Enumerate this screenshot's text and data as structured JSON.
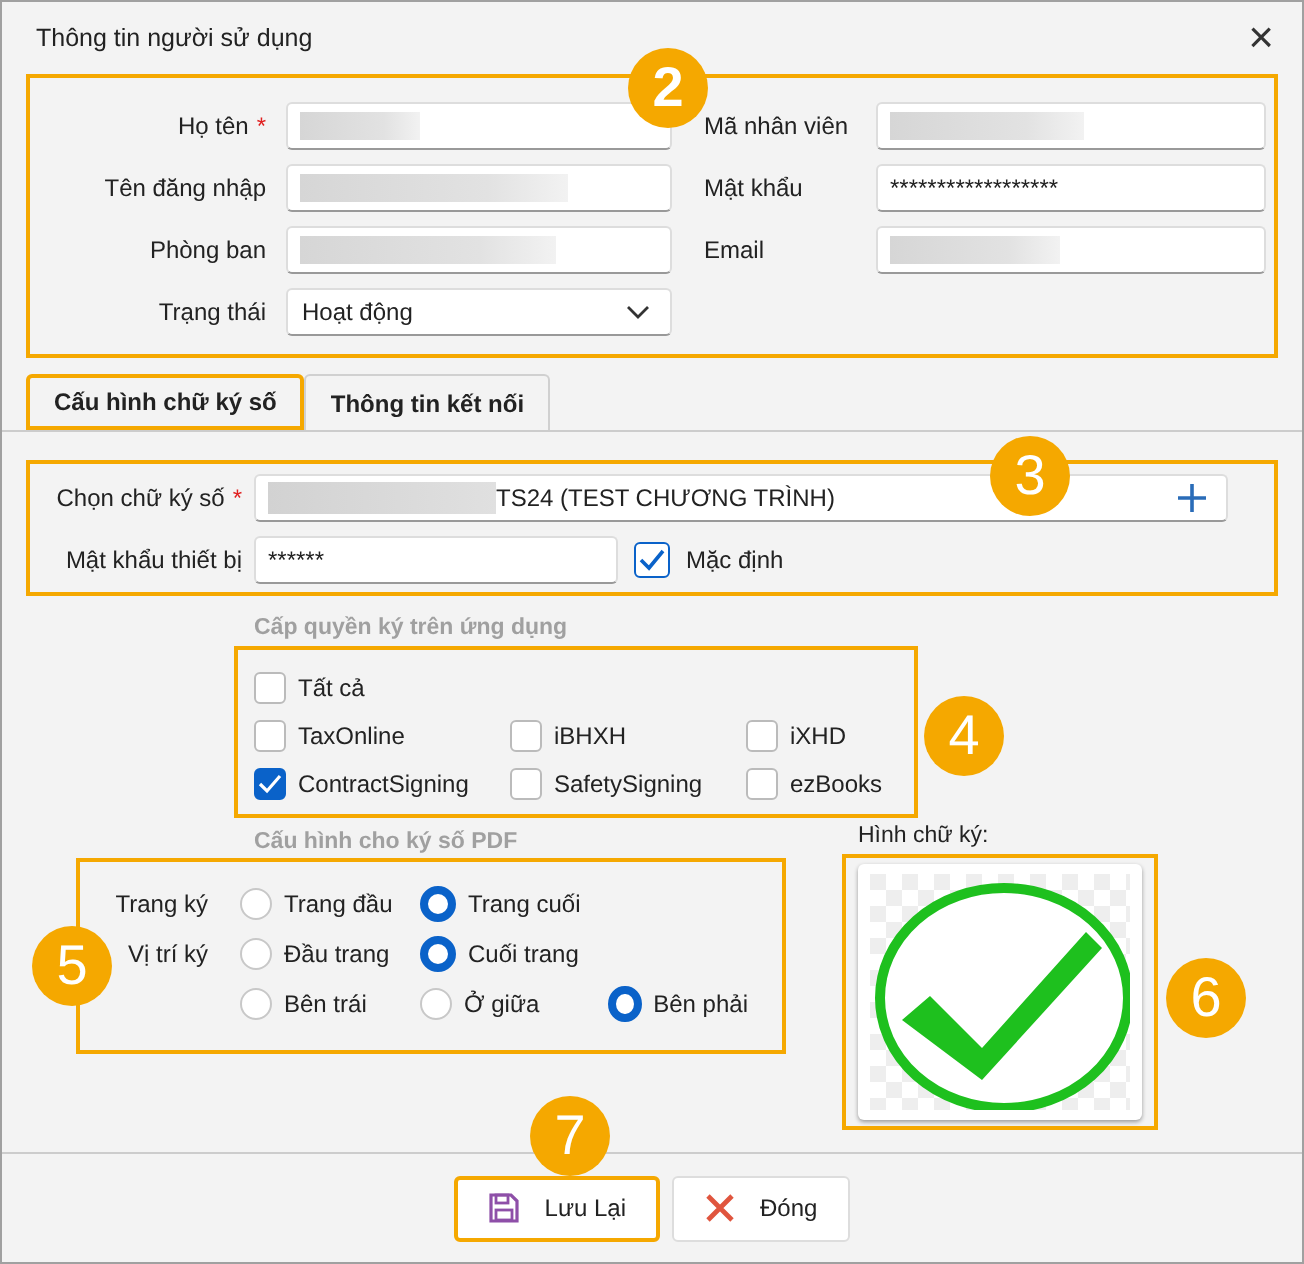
{
  "window": {
    "title": "Thông tin người sử dụng",
    "close": "×"
  },
  "user_section": {
    "badge": "2",
    "fields": [
      {
        "label": "Họ tên",
        "required_mark": "*",
        "redacted": true
      },
      {
        "label": "Mã nhân viên",
        "redacted": true
      },
      {
        "label": "Tên đăng nhập",
        "redacted": true
      },
      {
        "label": "Mật khẩu",
        "value": "******************"
      },
      {
        "label": "Phòng ban",
        "redacted": true
      },
      {
        "label": "Email",
        "redacted": true
      },
      {
        "label": "Trạng thái",
        "kind": "dropdown",
        "value": "Hoạt động"
      }
    ]
  },
  "tabs": [
    {
      "label": "Cấu hình chữ ký số",
      "selected": true
    },
    {
      "label": "Thông tin kết nối",
      "selected": false
    }
  ],
  "signature_section": {
    "badge": "3",
    "select_label": "Chọn chữ ký số",
    "required_mark": "*",
    "select_value": "TS24 (TEST CHƯƠNG TRÌNH)",
    "redacted_prefix": true,
    "device_password_label": "Mật khẩu thiết bị",
    "device_password": "******",
    "default_label": "Mặc định",
    "default_checked": true
  },
  "apps_section": {
    "heading": "Cấp quyền ký trên ứng dụng",
    "badge": "4",
    "all": {
      "label": "Tất cả",
      "checked": false
    },
    "apps": [
      {
        "label": "TaxOnline",
        "checked": false
      },
      {
        "label": "iBHXH",
        "checked": false
      },
      {
        "label": "iXHD",
        "checked": false
      },
      {
        "label": "ContractSigning",
        "checked": true
      },
      {
        "label": "SafetySigning",
        "checked": false
      },
      {
        "label": "ezBooks",
        "checked": false
      }
    ]
  },
  "pdf_section": {
    "heading": "Cấu hình cho ký số PDF",
    "badge": "5",
    "rows": [
      {
        "label": "Trang ký",
        "options": [
          {
            "label": "Trang đầu",
            "selected": false
          },
          {
            "label": "Trang cuối",
            "selected": true
          }
        ]
      },
      {
        "label": "Vị trí ký",
        "options": [
          {
            "label": "Đầu trang",
            "selected": false
          },
          {
            "label": "Cuối trang",
            "selected": true
          }
        ]
      },
      {
        "options": [
          {
            "label": "Bên trái",
            "selected": false
          },
          {
            "label": "Ở giữa",
            "selected": false
          },
          {
            "label": "Bên phải",
            "selected": true
          }
        ]
      }
    ]
  },
  "image_section": {
    "label": "Hình chữ ký:",
    "badge": "6"
  },
  "footer": {
    "badge": "7",
    "buttons": [
      {
        "label": "Lưu Lại",
        "kind": "save",
        "highlighted": true
      },
      {
        "label": "Đóng",
        "kind": "close",
        "highlighted": false
      }
    ]
  }
}
